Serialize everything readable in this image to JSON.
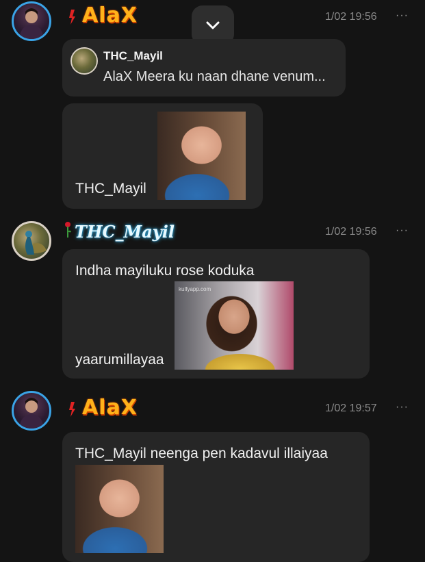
{
  "scroll_button": {
    "icon": "chevron-down-icon"
  },
  "messages": [
    {
      "sender": "AlaX",
      "time": "1/02 19:56",
      "more": "···",
      "reply": {
        "name": "THC_Mayil",
        "text": "AlaX Meera ku naan dhane venum..."
      },
      "text": "THC_Mayil",
      "gif": "crying-child-gif"
    },
    {
      "sender": "THC_Mayil",
      "time": "1/02 19:56",
      "more": "···",
      "text_line1": "Indha mayiluku rose koduka",
      "text_line2": "yaarumillayaa",
      "gif": "smiling-woman-gif",
      "gif_watermark": "kulfyapp.com"
    },
    {
      "sender": "AlaX",
      "time": "1/02 19:57",
      "more": "···",
      "text": "THC_Mayil  neenga pen kadavul illaiyaa",
      "gif": "crying-child-gif"
    }
  ],
  "colors": {
    "background": "#141414",
    "bubble": "#262626",
    "alax_name": "#ffb21a",
    "mayil_glow": "#3fc7ff",
    "avatar_ring_alax": "#3aa3e6"
  }
}
